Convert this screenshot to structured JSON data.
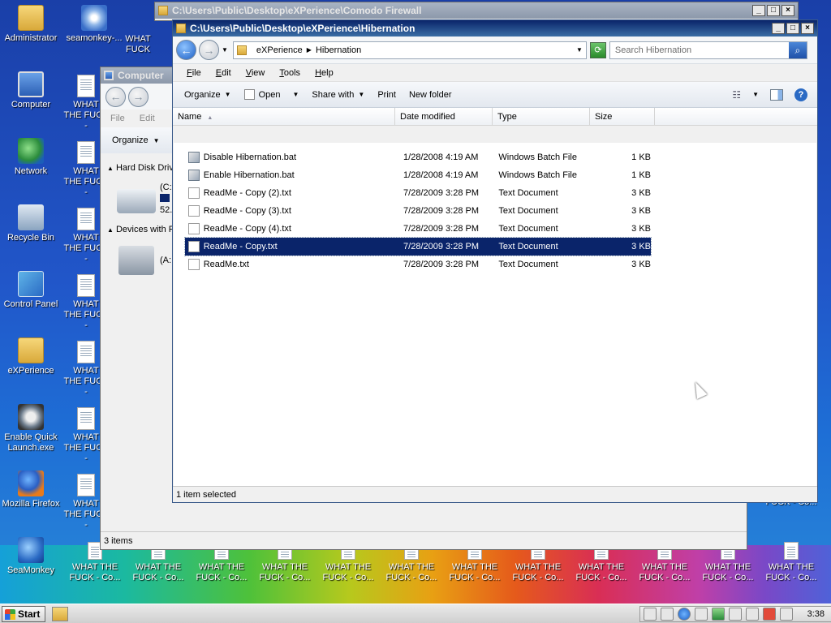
{
  "desktop_icons_left": [
    {
      "label": "Administrator",
      "icon": "user-folder-icon"
    },
    {
      "label": "Computer",
      "icon": "computer-icon"
    },
    {
      "label": "Network",
      "icon": "network-icon"
    },
    {
      "label": "Recycle Bin",
      "icon": "recycle-bin-icon"
    },
    {
      "label": "Control Panel",
      "icon": "control-panel-icon"
    },
    {
      "label": "eXPerience",
      "icon": "folder-icon"
    },
    {
      "label": "Enable Quick Launch.exe",
      "icon": "quick-launch-icon"
    },
    {
      "label": "Mozilla Firefox",
      "icon": "firefox-icon"
    },
    {
      "label": "SeaMonkey",
      "icon": "seamonkey-icon"
    }
  ],
  "desktop_icon_second_column_top": {
    "label": "seamonkey-...",
    "icon": "disc-icon"
  },
  "desktop_doc_label_short": "WHAT THE FUCK -",
  "desktop_doc_label_bottom": "WHAT THE FUCK - Co...",
  "desktop_doc_label_partial": "WHAT FUCK",
  "comodo_window": {
    "title": "C:\\Users\\Public\\Desktop\\eXPerience\\Comodo Firewall"
  },
  "computer_window": {
    "title": "Computer",
    "menu": [
      "File",
      "Edit"
    ],
    "organize": "Organize",
    "group_hard_disk": "Hard Disk Driv",
    "drive_c_label": "(C:",
    "drive_c_size": "52.",
    "group_devices": "Devices with R",
    "drive_a_label": "(A:",
    "status": "3 items"
  },
  "explorer": {
    "title": "C:\\Users\\Public\\Desktop\\eXPerience\\Hibernation",
    "breadcrumb": [
      "eXPerience",
      "Hibernation"
    ],
    "search_placeholder": "Search Hibernation",
    "menu": [
      "File",
      "Edit",
      "View",
      "Tools",
      "Help"
    ],
    "toolbar": {
      "organize": "Organize",
      "open": "Open",
      "share_with": "Share with",
      "print": "Print",
      "new_folder": "New folder"
    },
    "columns": [
      "Name",
      "Date modified",
      "Type",
      "Size"
    ],
    "files": [
      {
        "name": "Disable Hibernation.bat",
        "date": "1/28/2008 4:19 AM",
        "type": "Windows Batch File",
        "size": "1 KB",
        "kind": "bat",
        "selected": false
      },
      {
        "name": "Enable Hibernation.bat",
        "date": "1/28/2008 4:19 AM",
        "type": "Windows Batch File",
        "size": "1 KB",
        "kind": "bat",
        "selected": false
      },
      {
        "name": "ReadMe - Copy (2).txt",
        "date": "7/28/2009 3:28 PM",
        "type": "Text Document",
        "size": "3 KB",
        "kind": "txt",
        "selected": false
      },
      {
        "name": "ReadMe - Copy (3).txt",
        "date": "7/28/2009 3:28 PM",
        "type": "Text Document",
        "size": "3 KB",
        "kind": "txt",
        "selected": false
      },
      {
        "name": "ReadMe - Copy (4).txt",
        "date": "7/28/2009 3:28 PM",
        "type": "Text Document",
        "size": "3 KB",
        "kind": "txt",
        "selected": false
      },
      {
        "name": "ReadMe - Copy.txt",
        "date": "7/28/2009 3:28 PM",
        "type": "Text Document",
        "size": "3 KB",
        "kind": "txt",
        "selected": true
      },
      {
        "name": "ReadMe.txt",
        "date": "7/28/2009 3:28 PM",
        "type": "Text Document",
        "size": "3 KB",
        "kind": "txt",
        "selected": false
      }
    ],
    "status": "1 item selected"
  },
  "taskbar": {
    "start_label": "Start",
    "clock": "3:38"
  },
  "colors": {
    "selection": "#0a246a",
    "titlebar_active": "#0a246a"
  }
}
